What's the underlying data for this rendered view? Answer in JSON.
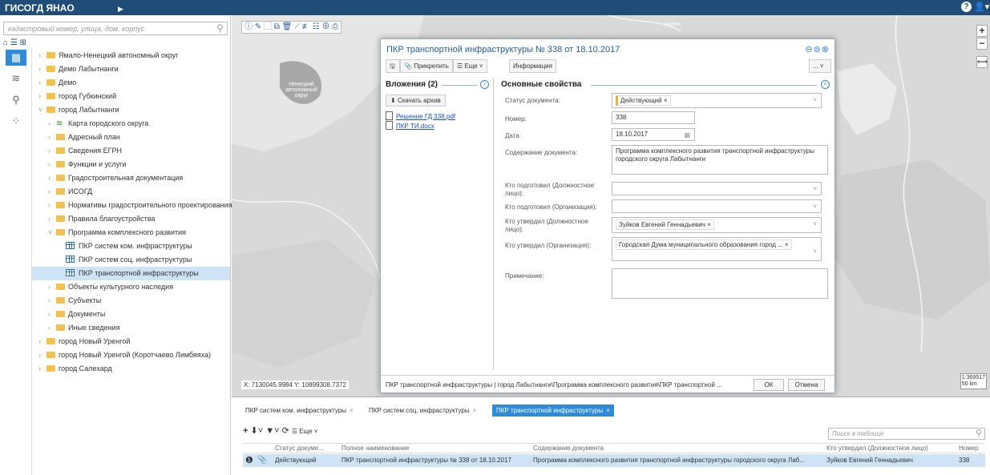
{
  "app": {
    "title": "ГИСОГД ЯНАО"
  },
  "search": {
    "placeholder": "кадастровый номер, улица, дом, корпус"
  },
  "tree": [
    {
      "label": "Ямало-Ненецкий автономный округ",
      "type": "folder"
    },
    {
      "label": "Демо Лабытнанги",
      "type": "folder"
    },
    {
      "label": "Демо",
      "type": "folder"
    },
    {
      "label": "город Губкинский",
      "type": "folder"
    },
    {
      "label": "город Лабытнанги",
      "type": "folder"
    },
    {
      "label": "Карта городского округа",
      "type": "layers"
    },
    {
      "label": "Адресный план",
      "type": "folder"
    },
    {
      "label": "Сведения ЕГРН",
      "type": "folder"
    },
    {
      "label": "Функции и услуги",
      "type": "folder"
    },
    {
      "label": "Градостроительная документация",
      "type": "folder"
    },
    {
      "label": "ИСОГД",
      "type": "folder"
    },
    {
      "label": "Нормативы градостроительного проектирования",
      "type": "folder"
    },
    {
      "label": "Правила благоустройства",
      "type": "folder"
    },
    {
      "label": "Программа комплексного развития",
      "type": "folder"
    },
    {
      "label": "ПКР систем ком. инфраструктуры",
      "type": "table"
    },
    {
      "label": "ПКР систем соц. инфраструктуры",
      "type": "table"
    },
    {
      "label": "ПКР транспортной инфраструктуры",
      "type": "table"
    },
    {
      "label": "Объекты культурного наследия",
      "type": "folder"
    },
    {
      "label": "Субъекты",
      "type": "folder"
    },
    {
      "label": "Документы",
      "type": "folder"
    },
    {
      "label": "Иные сведения",
      "type": "folder"
    },
    {
      "label": "город Новый Уренгой",
      "type": "folder"
    },
    {
      "label": "город Новый Уренгой (Коротчаево Лимбяяха)",
      "type": "folder"
    },
    {
      "label": "город Салехард",
      "type": "folder"
    }
  ],
  "map": {
    "coords": "X: 7130045.9984  Y: 10899308.7372",
    "scale_ratio": "1:369517",
    "scale_km": "50 km",
    "label_1": "Ненецкий автономный округ",
    "label_2": "район"
  },
  "dialog": {
    "title": "ПКР транспортной инфраструктуры № 338 от 18.10.2017",
    "attach_label": "Прикрепить",
    "more_label": "Еще",
    "info_label": "Информация",
    "attachments_title": "Вложения (2)",
    "download_label": "Скачать архив",
    "files": [
      "Решение ГД 338.pdf",
      "ПКР ТИ.docx"
    ],
    "props_title": "Основные свойства",
    "fields": {
      "status_label": "Статус документа:",
      "status_value": "Действующий",
      "number_label": "Номер:",
      "number_value": "338",
      "date_label": "Дата:",
      "date_value": "18.10.2017",
      "content_label": "Содержание документа:",
      "content_value": "Программа комплексного развития транспортной инфраструктуры городского округа Лабытнанги",
      "prepared_pos_label": "Кто подготовил (Должностное лицо):",
      "prepared_org_label": "Кто подготовил (Организация):",
      "approved_pos_label": "Кто утвердил (Должностное лицо):",
      "approved_pos_value": "Зуйков Евгений Геннадьевич",
      "approved_org_label": "Кто утвердил (Организация):",
      "approved_org_value": "Городская Дума муниципального образования город ...",
      "note_label": "Примечание:"
    },
    "footer_path": "ПКР транспортной инфраструктуры  |  город Лабытнанги\\Программа комплексного развития\\ПКР транспортной ...",
    "ok_label": "ОК",
    "cancel_label": "Отмена"
  },
  "bottom": {
    "tabs": [
      "ПКР систем ком. инфраструктуры",
      "ПКР систем соц. инфраструктуры",
      "ПКР транспортной инфраструктуры"
    ],
    "more_label": "Еще",
    "search_placeholder": "Поиск в таблице",
    "columns": [
      "Статус докуме...",
      "Полное наименование",
      "Содержание документа",
      "Кто утвердил (Должностное лицо)",
      "Номер"
    ],
    "row": {
      "status": "Действующий",
      "name": "ПКР транспортной инфраструктуры № 338 от 18.10.2017",
      "content": "Программа комплексного развития транспортной инфраструктуры городского округа Лаб...",
      "approved": "Зуйков Евгений Геннадьевич",
      "number": "338"
    }
  },
  "colors": {
    "topbar": "#1f4d78",
    "accent": "#2f8ad8",
    "selection": "#cfe3f6",
    "folder": "#f2c14e"
  }
}
